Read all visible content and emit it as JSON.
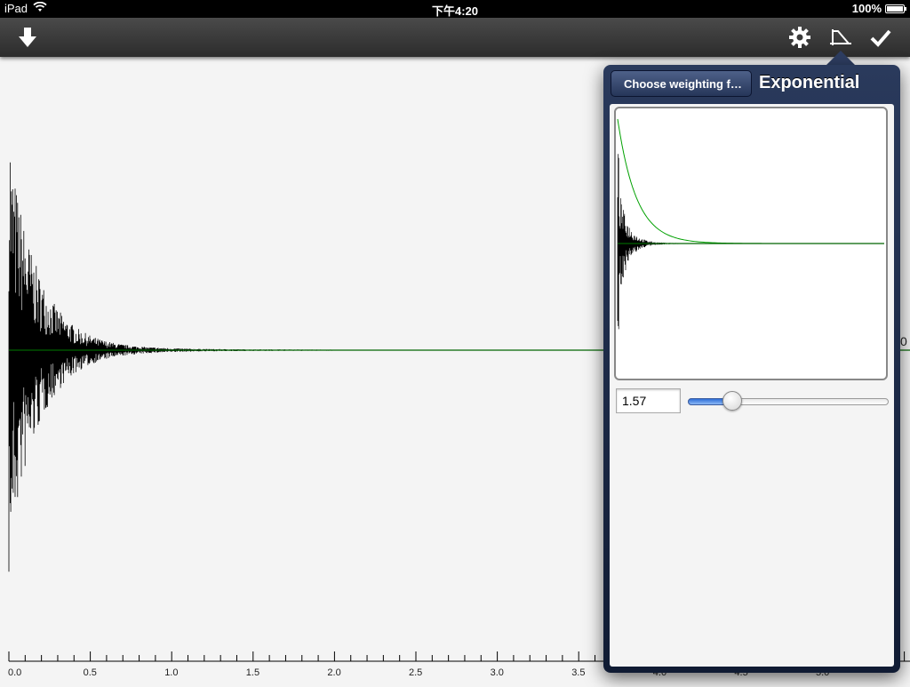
{
  "status_bar": {
    "device": "iPad",
    "time": "下午4:20",
    "battery": "100%",
    "battery_level": 1.0
  },
  "toolbar": {
    "left_icons": [
      "download-arrow-icon"
    ],
    "right_icons": [
      "gear-icon",
      "weighting-function-icon",
      "checkmark-icon"
    ]
  },
  "popover": {
    "back_label": "Choose weighting fun...",
    "title": "Exponential",
    "value": "1.57",
    "slider_level": 0.19
  },
  "chart_data": {
    "type": "line",
    "xlabel": "",
    "ylabel": "",
    "xlim": [
      0.0,
      5.5
    ],
    "x_ticks": [
      "0.0",
      "0.5",
      "1.0",
      "1.5",
      "2.0",
      "2.5",
      "3.0",
      "3.5",
      "4.0",
      "4.5",
      "5.0"
    ],
    "minor_tick_step": 0.1,
    "series": [
      {
        "color": "#000000",
        "values_description": ""
      },
      {
        "color": "#008000"
      }
    ],
    "edge_label": "0"
  },
  "colors": {
    "waveform": "#000000",
    "envelope": "#00a000",
    "baseline": "#006400",
    "toolbar": "#3a3a3a",
    "popover_frame": "#1d2a48",
    "slider_fill": "#3a7fe0"
  }
}
